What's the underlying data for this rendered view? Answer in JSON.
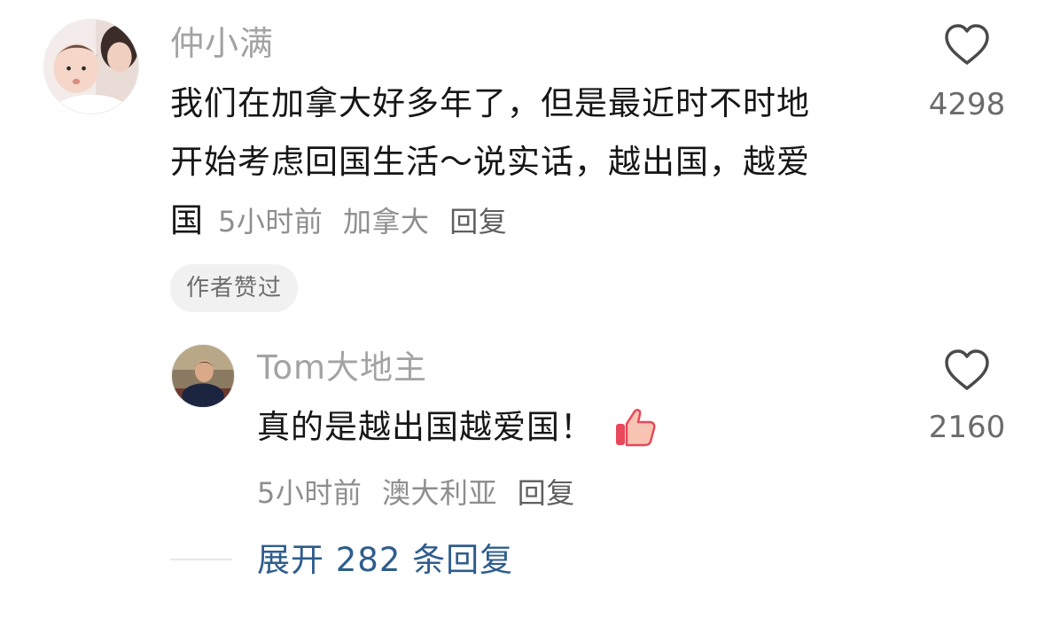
{
  "comment": {
    "username": "仲小满",
    "text_line1": "我们在加拿大好多年了，但是最近时不时地",
    "text_line2": "开始考虑回国生活～说实话，越出国，越爱",
    "text_line3": "国",
    "time": "5小时前",
    "location": "加拿大",
    "reply_label": "回复",
    "like_count": "4298",
    "author_badge": "作者赞过",
    "like_icon": "heart-outline-icon"
  },
  "reply": {
    "username": "Tom大地主",
    "text": "真的是越出国越爱国！",
    "emoji_icon": "thumbs-up-icon",
    "time": "5小时前",
    "location": "澳大利亚",
    "reply_label": "回复",
    "like_count": "2160",
    "like_icon": "heart-outline-icon"
  },
  "expand": {
    "label": "展开 282 条回复"
  },
  "colors": {
    "username": "#a3a3a3",
    "text": "#161616",
    "meta": "#8e8e8e",
    "link": "#2f5d8c",
    "badge_bg": "#f1f1f1"
  }
}
